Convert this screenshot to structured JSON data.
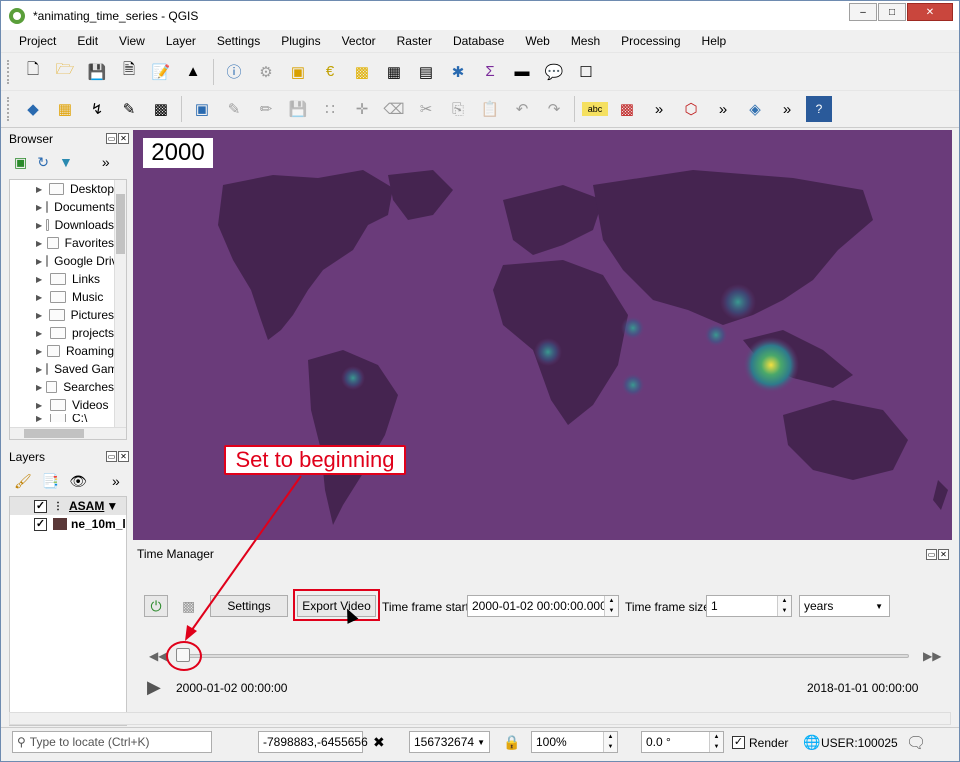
{
  "window": {
    "title": "*animating_time_series - QGIS",
    "controls": [
      "minimize",
      "maximize",
      "close"
    ]
  },
  "menu": [
    "Project",
    "Edit",
    "View",
    "Layer",
    "Settings",
    "Plugins",
    "Vector",
    "Raster",
    "Database",
    "Web",
    "Mesh",
    "Processing",
    "Help"
  ],
  "toolbar1_icons": [
    "new-project-icon",
    "open-project-icon",
    "save-project-icon",
    "print-layout-icon",
    "layout-manager-icon",
    "style-manager-icon",
    "identify-icon",
    "zoom-icon",
    "select-icon",
    "select-dropdown-icon",
    "field-calculator-icon",
    "deselect-icon",
    "attribute-table-icon",
    "statistics-icon",
    "processing-toolbox-icon",
    "sum-icon",
    "measure-icon",
    "annotation-icon",
    "text-annotation-icon"
  ],
  "browser": {
    "title": "Browser",
    "items": [
      "Desktop",
      "Documents",
      "Downloads",
      "Favorites",
      "Google Drive",
      "Links",
      "Music",
      "Pictures",
      "projects",
      "Roaming",
      "Saved Games",
      "Searches",
      "Videos",
      "C:\\"
    ]
  },
  "layers": {
    "title": "Layers",
    "items": [
      {
        "name": "ASAM",
        "checked": true
      },
      {
        "name": "ne_10m_l",
        "checked": true
      }
    ]
  },
  "map": {
    "year_label": "2000",
    "background": "#6a3b7a"
  },
  "time_manager": {
    "title": "Time Manager",
    "settings_label": "Settings",
    "export_label": "Export Video",
    "frame_start_label": "Time frame start",
    "frame_start_value": "2000-01-02 00:00:00.000",
    "frame_size_label": "Time frame size",
    "frame_size_value": "1",
    "unit_value": "years",
    "start_time": "2000-01-02 00:00:00",
    "end_time": "2018-01-01 00:00:00",
    "slider_position": 0
  },
  "annotation": {
    "text": "Set to beginning",
    "color": "#e0001a"
  },
  "statusbar": {
    "locate_placeholder": "Type to locate (Ctrl+K)",
    "coordinate_label": "",
    "coordinate": "-7898883,-6455656",
    "scale_label": "",
    "scale": "156732674",
    "magnifier_label": "",
    "magnifier": "100%",
    "rotation_label": "",
    "rotation": "0.0 °",
    "render_label": "Render",
    "crs": "USER:100025"
  }
}
